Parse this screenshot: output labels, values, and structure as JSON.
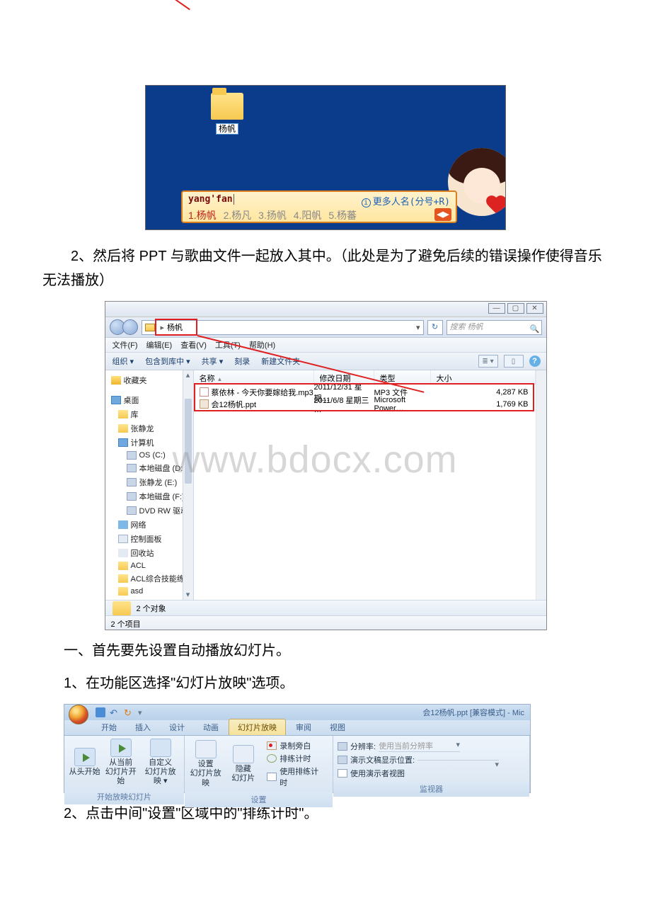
{
  "image1": {
    "folder_label": "杨帆",
    "ime_input": "yang'fan",
    "ime_more": "更多人名(分号+R)",
    "candidates": [
      "1.杨帆",
      "2.杨凡",
      "3.扬帆",
      "4.阳帆",
      "5.杨蕃"
    ]
  },
  "para_2_prefix": "2、然后将 PPT 与歌曲文件一起放入其中。（此处是为了避免后续的错误操作使得音乐无法播放）",
  "explorer": {
    "path_current": "杨帆",
    "search_placeholder": "搜索 杨帆",
    "menu": [
      "文件(F)",
      "编辑(E)",
      "查看(V)",
      "工具(T)",
      "帮助(H)"
    ],
    "toolbar": [
      "组织 ▾",
      "包含到库中 ▾",
      "共享 ▾",
      "刻录",
      "新建文件夹"
    ],
    "columns": [
      "名称",
      "修改日期",
      "类型",
      "大小"
    ],
    "files": [
      {
        "name": "蔡依林 - 今天你要嫁给我.mp3",
        "date": "2011/12/31 星期…",
        "type": "MP3 文件",
        "size": "4,287 KB"
      },
      {
        "name": "会12杨帆.ppt",
        "date": "2011/6/8 星期三 …",
        "type": "Microsoft Power…",
        "size": "1,769 KB"
      }
    ],
    "sidebar_fav": "收藏夹",
    "sidebar_items": [
      "桌面",
      "库",
      "张静龙",
      "计算机",
      "OS (C:)",
      "本地磁盘 (D:)",
      "张静龙 (E:)",
      "本地磁盘 (F:)",
      "DVD RW 驱动器",
      "网络",
      "控制面板",
      "回收站",
      "ACL",
      "ACL综合技能练习",
      "asd"
    ],
    "status_objects": "2 个对象",
    "status_items": "2 个项目",
    "watermark": "www.bdocx.com"
  },
  "para_sec1": "一、首先要先设置自动播放幻灯片。",
  "para_1_1": "1、在功能区选择\"幻灯片放映\"选项。",
  "ppt": {
    "title": "会12杨帆.ppt [兼容模式] - Mic",
    "tabs": [
      "开始",
      "插入",
      "设计",
      "动画",
      "幻灯片放映",
      "审阅",
      "视图"
    ],
    "group1": {
      "btn1_l1": "从头开始",
      "btn2_l1": "从当前",
      "btn2_l2": "幻灯片开始",
      "btn3_l1": "自定义",
      "btn3_l2": "幻灯片放映 ▾",
      "label": "开始放映幻灯片"
    },
    "group2": {
      "btn1_l1": "设置",
      "btn1_l2": "幻灯片放映",
      "btn2_l1": "隐藏",
      "btn2_l2": "幻灯片",
      "s1": "录制旁白",
      "s2": "排练计时",
      "s3": "使用排练计时",
      "label": "设置"
    },
    "group3": {
      "r1_label": "分辨率:",
      "r1_val": "使用当前分辨率",
      "r2_label": "演示文稿显示位置:",
      "r3_label": "使用演示者视图",
      "label": "监视器"
    }
  },
  "para_2_2": "2、点击中间\"设置\"区域中的\"排练计时\"。"
}
